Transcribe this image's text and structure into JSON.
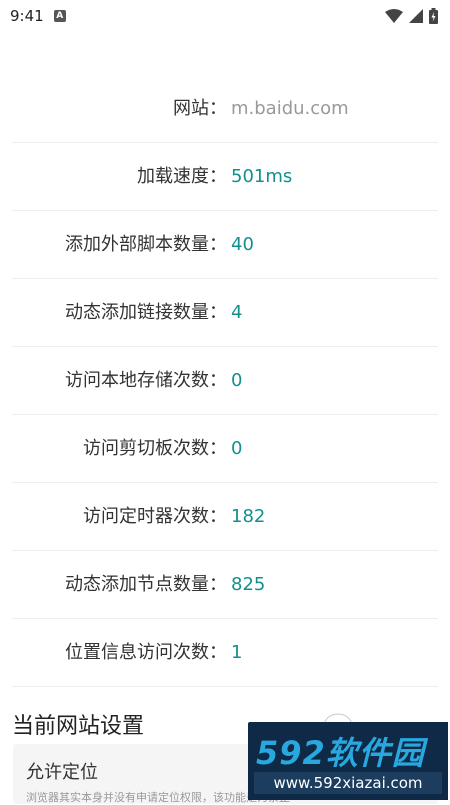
{
  "status_bar": {
    "time": "9:41",
    "notification_icon": "A"
  },
  "info_rows": [
    {
      "label": "网站：",
      "value": "m.baidu.com",
      "muted": true
    },
    {
      "label": "加载速度：",
      "value": "501ms"
    },
    {
      "label": "添加外部脚本数量：",
      "value": "40"
    },
    {
      "label": "动态添加链接数量：",
      "value": "4"
    },
    {
      "label": "访问本地存储次数：",
      "value": "0"
    },
    {
      "label": "访问剪切板次数：",
      "value": "0"
    },
    {
      "label": "访问定时器次数：",
      "value": "182"
    },
    {
      "label": "动态添加节点数量：",
      "value": "825"
    },
    {
      "label": "位置信息访问次数：",
      "value": "1"
    }
  ],
  "settings": {
    "section_title": "当前网站设置",
    "location_title": "允许定位",
    "location_desc": "浏览器其实本身并没有申请定位权限，该功能是为禁止"
  },
  "watermark": {
    "brand": "592软件园",
    "url": "www.592xiazai.com"
  },
  "colors": {
    "accent": "#12918c",
    "muted": "#999999"
  }
}
